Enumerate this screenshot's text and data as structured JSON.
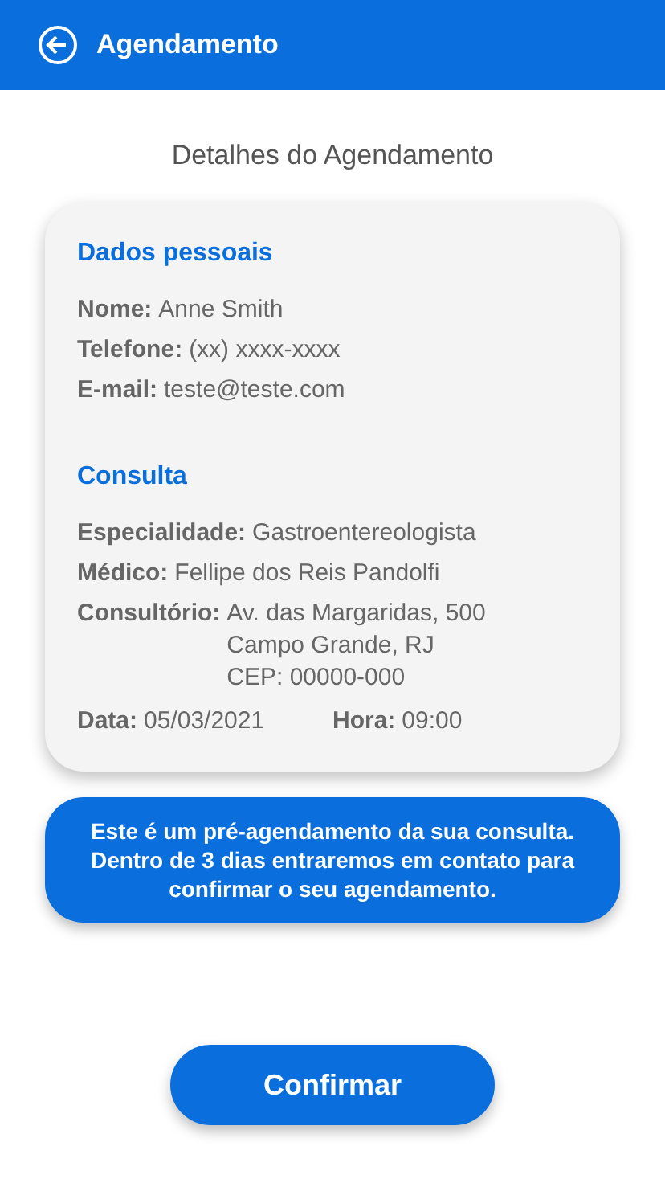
{
  "header": {
    "title": "Agendamento"
  },
  "page_title": "Detalhes do Agendamento",
  "card": {
    "sections": [
      {
        "title": "Dados pessoais",
        "fields": [
          {
            "label": "Nome:",
            "lines": [
              "Anne Smith"
            ]
          },
          {
            "label": "Telefone:",
            "lines": [
              "(xx) xxxx-xxxx"
            ]
          },
          {
            "label": "E-mail:",
            "lines": [
              "teste@teste.com"
            ]
          }
        ]
      },
      {
        "title": "Consulta",
        "fields": [
          {
            "label": "Especialidade:",
            "lines": [
              "Gastroentereologista"
            ]
          },
          {
            "label": "Médico:",
            "lines": [
              "Fellipe dos Reis Pandolfi"
            ]
          },
          {
            "label": "Consultório:",
            "lines": [
              "Av. das Margaridas, 500",
              "Campo Grande, RJ",
              "CEP: 00000-000"
            ]
          }
        ],
        "inline_fields": [
          {
            "label": "Data:",
            "value": "05/03/2021"
          },
          {
            "label": "Hora:",
            "value": "09:00"
          }
        ]
      }
    ]
  },
  "notice": "Este é um pré-agendamento da sua consulta. Dentro de 3 dias entraremos em contato para confirmar o seu agendamento.",
  "confirm_button": "Confirmar"
}
